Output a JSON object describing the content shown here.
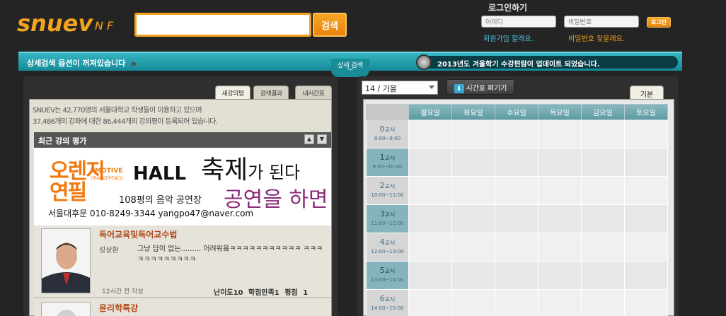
{
  "header": {
    "logo_text": "snuev",
    "logo_suffix": "N F",
    "search_value": "",
    "search_button": "검색"
  },
  "login": {
    "title": "로그인하기",
    "id_placeholder": "아이디",
    "pw_placeholder": "비밀번호",
    "login_button": "로그인",
    "signup": "회원가입 할래요.",
    "find_password": "비밀번호 찾을래요."
  },
  "bar": {
    "advanced_message": "상세검색 옵션이 꺼져있습니다",
    "advanced_tab": "상세 검색",
    "notice": "2013년도 겨울학기 수강편람이 업데이트 되었습니다."
  },
  "left": {
    "tabs": [
      "새강의평",
      "검색결과",
      "내시간표"
    ],
    "info_line1": "SNUEV는 42,770명의 서울대학교 학생들이 이용하고 있으며",
    "info_line2": "37,486개의 강좌에 대한 86,444개의 강의평이 등록되어 있습니다.",
    "recent_title": "최근 강의 평가",
    "ad": {
      "orange_line1": "오렌지",
      "orange_line2": "연필",
      "emotive": "EMOTIVE",
      "orangepencil": "ORANGEPENCIL",
      "hall": "HALL",
      "fest_big": "축제",
      "fest_small": "가 된다",
      "perform": "공연을 하면",
      "place": "108평의 음악 공연장",
      "contact": "서울대후문 010-8249-3344  yangpo47@naver.com"
    },
    "reviews": [
      {
        "course": "독어교육및독어교수법",
        "professor": "성상환",
        "text": "그냥 답이 없는......... 어려워욬ㅋㅋㅋㅋㅋㅋㅋㅋㅋㅋㅋ ㅋㅋㅋㅋㅋㅋㅋㅋㅋㅋㅋㅋ",
        "time": "12시간 전 작성",
        "scores": "난이도10 학점만족1 평점 1"
      },
      {
        "course": "윤리학특강",
        "professor": "",
        "text": "",
        "time": "",
        "scores": ""
      }
    ]
  },
  "right": {
    "semester": "14 / 가을",
    "open_timetable": "시간표 펴기기",
    "basic_tab": "기본",
    "days": [
      "월요일",
      "화요일",
      "수요일",
      "목요일",
      "금요일",
      "토요일"
    ],
    "periods": [
      {
        "num": "0",
        "unit": "교시",
        "time": "8:00~9:00"
      },
      {
        "num": "1",
        "unit": "교시",
        "time": "9:00~10:00"
      },
      {
        "num": "2",
        "unit": "교시",
        "time": "10:00~11:00"
      },
      {
        "num": "3",
        "unit": "교시",
        "time": "11:00~12:00"
      },
      {
        "num": "4",
        "unit": "교시",
        "time": "12:00~13:00"
      },
      {
        "num": "5",
        "unit": "교시",
        "time": "13:00~14:00"
      },
      {
        "num": "6",
        "unit": "교시",
        "time": "14:00~15:00"
      }
    ]
  },
  "colors": {
    "accent_orange": "#f2a21e",
    "teal": "#1e9aa8",
    "background": "#242424"
  }
}
